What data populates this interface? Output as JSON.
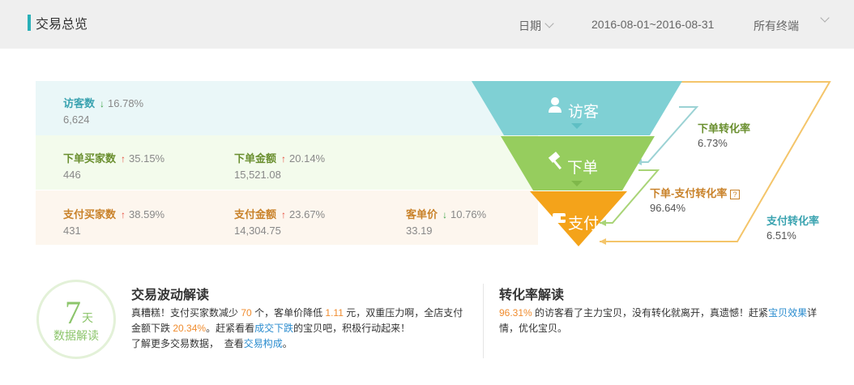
{
  "header": {
    "title": "交易总览",
    "date_label": "日期",
    "date_range": "2016-08-01~2016-08-31",
    "terminal": "所有终端"
  },
  "visitors": {
    "label": "访客数",
    "trend": "down",
    "pct": "16.78%",
    "value": "6,624"
  },
  "order": {
    "buyers_label": "下单买家数",
    "buyers_trend": "up",
    "buyers_pct": "35.15%",
    "buyers_value": "446",
    "amount_label": "下单金额",
    "amount_trend": "up",
    "amount_pct": "20.14%",
    "amount_value": "15,521.08"
  },
  "pay": {
    "buyers_label": "支付买家数",
    "buyers_trend": "up",
    "buyers_pct": "38.59%",
    "buyers_value": "431",
    "amount_label": "支付金额",
    "amount_trend": "up",
    "amount_pct": "23.67%",
    "amount_value": "14,304.75",
    "price_label": "客单价",
    "price_trend": "down",
    "price_pct": "10.76%",
    "price_value": "33.19"
  },
  "funnel": {
    "visit": "访客",
    "order": "下单",
    "pay": "支付"
  },
  "rates": {
    "order_label": "下单转化率",
    "order_value": "6.73%",
    "order_pay_label": "下单-支付转化率",
    "order_pay_value": "96.64%",
    "pay_label": "支付转化率",
    "pay_value": "6.51%"
  },
  "badge": {
    "number": "7",
    "unit": "天",
    "text": "数据解读"
  },
  "fluct": {
    "title": "交易波动解读",
    "p1": "真糟糕！支付买家数减少",
    "v1": "70",
    "p2": "个，客单价降低",
    "v2": "1.11",
    "p3": "元，双重压力啊，全店支付金额下跌",
    "v3": "20.34%",
    "p4": "。赶紧看看",
    "link1": "成交下跌",
    "p5": "的宝贝吧，积极行动起来！",
    "p6": "了解更多交易数据，",
    "p7": "查看",
    "link2": "交易构成",
    "p8": "。"
  },
  "conv": {
    "title": "转化率解读",
    "v1": "96.31%",
    "p1": "的访客看了主力宝贝，没有转化就离开，真遗憾！赶紧",
    "link1": "宝贝效果",
    "p2": "详情，优化宝贝。"
  },
  "colors": {
    "teal": "#7fd0d4",
    "green": "#96cd5e",
    "orange": "#f4a31a",
    "down_arrow": "#3ca347",
    "up_arrow": "#e74c3c",
    "highlight": "#f08c2e",
    "link": "#2a8ccf"
  }
}
